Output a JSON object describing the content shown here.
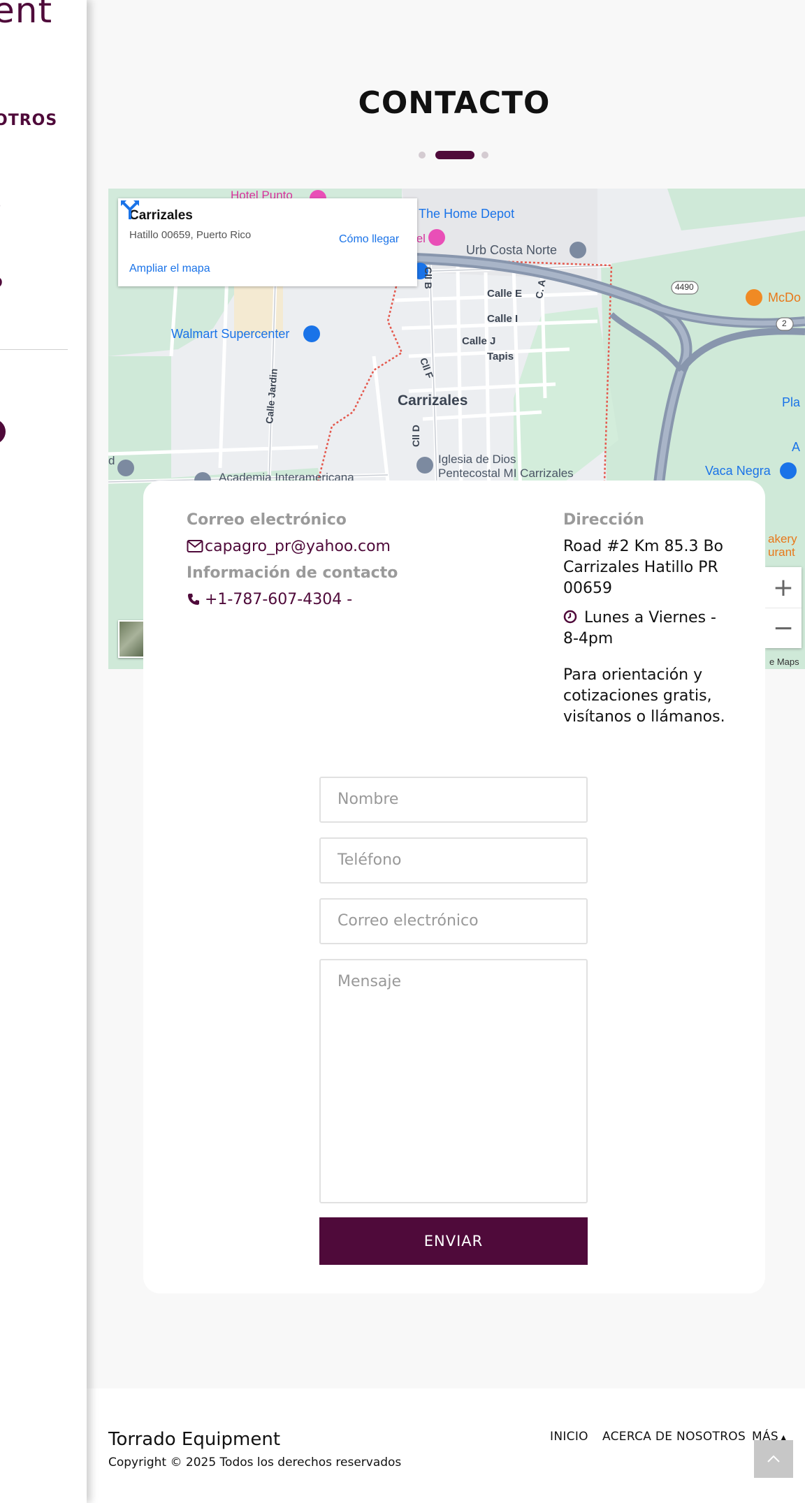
{
  "sidebar": {
    "logo_fragment": "ent",
    "nav_fragment": "OTROS"
  },
  "page": {
    "title": "CONTACTO"
  },
  "map": {
    "place_name": "Carrizales",
    "place_address": "Hatillo 00659, Puerto Rico",
    "directions_label": "Cómo llegar",
    "enlarge_label": "Ampliar el mapa",
    "zoom_in": "+",
    "zoom_out": "−",
    "attribution": "e Maps",
    "labels": {
      "home_depot": "The Home Depot",
      "hotel_punto": "Hotel Punto",
      "tel": "tel",
      "urb_costa_norte": "Urb Costa Norte",
      "route_4490": "4490",
      "route_2": "2",
      "mcdo": "McDo",
      "walmart": "Walmart Supercenter",
      "calle_e": "Calle E",
      "calle_i": "Calle I",
      "calle_j": "Calle J",
      "tapis": "Tapis",
      "cll_b": "Cll B",
      "c_a": "C. A",
      "cll_f": "Cll F",
      "cll_d": "Cll D",
      "calle_jardin": "Calle Jardin",
      "carrizales": "Carrizales",
      "iglesia_line1": "Iglesia de Dios",
      "iglesia_line2": "Pentecostal MI Carrizales",
      "academia": "Academia Interamericana",
      "vaca_negra": "Vaca Negra",
      "pla": "Pla",
      "akery": "akery",
      "urant": "urant",
      "a_edge": "A",
      "d_edge": "d"
    }
  },
  "contact": {
    "email_label": "Correo electrónico",
    "email_value": "capagro_pr@yahoo.com",
    "info_label": "Información de contacto",
    "phone_value": "+1-787-607-4304 -",
    "address_label": "Dirección",
    "address_line1": "Road #2 Km 85.3 Bo",
    "address_line2": "Carrizales Hatillo PR",
    "address_line3": "00659",
    "hours_line1": "Lunes a Viernes  -",
    "hours_line2": "8-4pm",
    "note_line1": "Para orientación y",
    "note_line2": "cotizaciones gratis,",
    "note_line3": "visítanos o llámanos."
  },
  "form": {
    "name_placeholder": "Nombre",
    "phone_placeholder": "Teléfono",
    "email_placeholder": "Correo electrónico",
    "message_placeholder": "Mensaje",
    "submit_label": "ENVIAR"
  },
  "footer": {
    "brand": "Torrado Equipment",
    "copyright": "Copyright © 2025 Todos los derechos reservados",
    "nav": {
      "inicio": "INICIO",
      "acerca": "ACERCA DE NOSOTROS",
      "mas": "MÁS"
    }
  },
  "colors": {
    "brand": "#4f0a3a",
    "link": "#1a73e8"
  }
}
